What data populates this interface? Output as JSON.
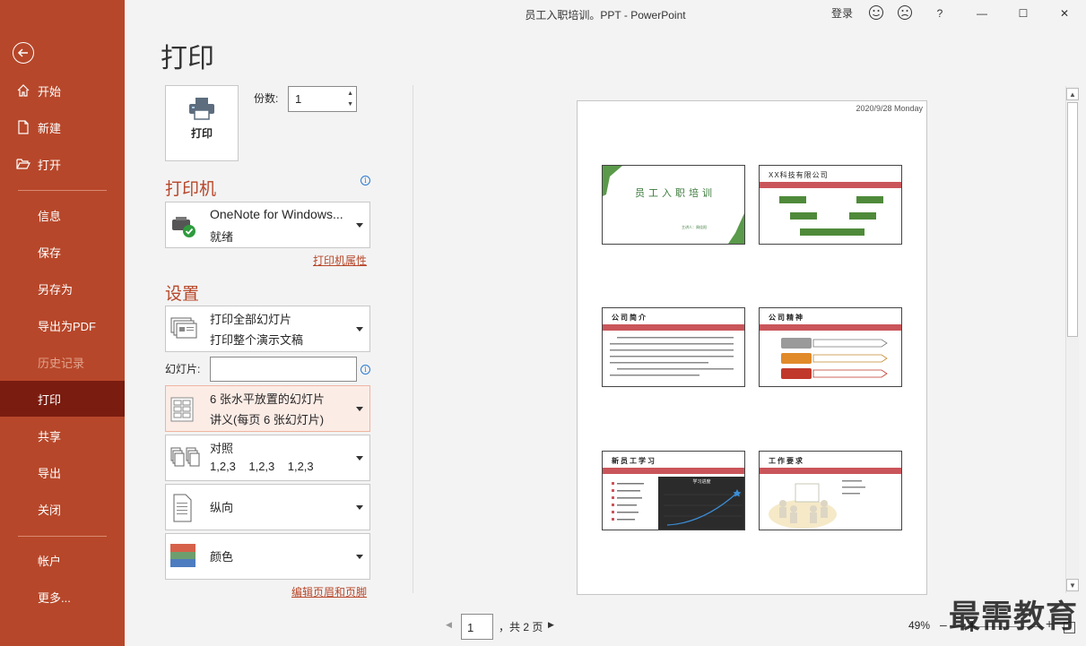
{
  "window": {
    "title": "员工入职培训。PPT  -  PowerPoint",
    "login": "登录",
    "help": "?",
    "minimize": "—",
    "maximize": "☐",
    "close": "✕"
  },
  "nav": {
    "items": [
      {
        "label": "开始",
        "icon": "home-icon"
      },
      {
        "label": "新建",
        "icon": "new-file-icon"
      },
      {
        "label": "打开",
        "icon": "folder-open-icon"
      },
      {
        "label": "信息"
      },
      {
        "label": "保存"
      },
      {
        "label": "另存为"
      },
      {
        "label": "导出为PDF"
      },
      {
        "label": "历史记录",
        "disabled": true
      },
      {
        "label": "打印",
        "active": true
      },
      {
        "label": "共享"
      },
      {
        "label": "导出"
      },
      {
        "label": "关闭"
      },
      {
        "label": "帐户"
      },
      {
        "label": "更多..."
      }
    ]
  },
  "print": {
    "heading": "打印",
    "button_label": "打印",
    "copies_label": "份数:",
    "copies_value": "1",
    "printer_heading": "打印机",
    "printer_name": "OneNote for Windows...",
    "printer_status": "就绪",
    "printer_props": "打印机属性",
    "settings_heading": "设置",
    "range_main": "打印全部幻灯片",
    "range_sub": "打印整个演示文稿",
    "slides_label": "幻灯片:",
    "layout_main": "6 张水平放置的幻灯片",
    "layout_sub": "讲义(每页 6 张幻灯片)",
    "collate_main": "对照",
    "collate_sub": "1,2,3    1,2,3    1,2,3",
    "orientation": "纵向",
    "color": "颜色",
    "edit_header_footer": "编辑页眉和页脚"
  },
  "preview": {
    "date": "2020/9/28 Monday",
    "slides": [
      {
        "title": "员工入职培训",
        "subtitle": "主讲人：周佳阳"
      },
      {
        "title": "XX科技有限公司"
      },
      {
        "title": "公司简介"
      },
      {
        "title": "公司精神"
      },
      {
        "title": "新员工学习",
        "chart_title": "学习进度"
      },
      {
        "title": "工作要求"
      }
    ]
  },
  "footer": {
    "page_current": "1",
    "page_total": "，共 2 页",
    "zoom": "49%",
    "zoom_minus": "–",
    "zoom_plus": "+",
    "zoom_fraction": 0.21
  },
  "watermark": "最需教育"
}
